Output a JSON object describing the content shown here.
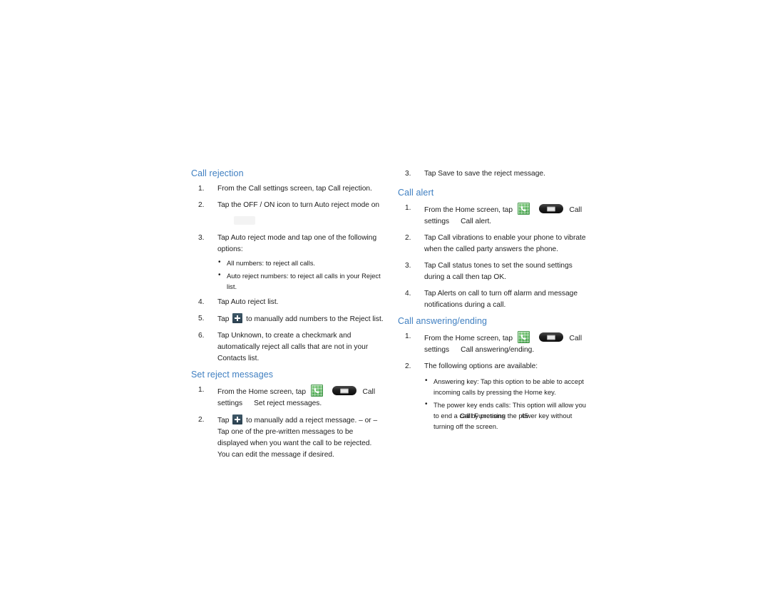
{
  "document": {
    "footer": {
      "chapter": "Call Functions",
      "page_number": "45"
    }
  },
  "left_column": {
    "sections": [
      {
        "heading": "Call rejection",
        "steps": [
          {
            "num": "1.",
            "text": "From the Call settings screen, tap Call rejection."
          },
          {
            "num": "2.",
            "text": "Tap the OFF / ON icon to turn Auto reject mode on"
          },
          {
            "num": "3.",
            "text": "Tap Auto reject mode and tap one of the following options:"
          },
          {
            "num": "4.",
            "text": "Tap Auto reject list."
          },
          {
            "num": "5.",
            "text": "Tap"
          },
          {
            "num": "6.",
            "text": "Tap Unknown, to create a checkmark and automatically reject all calls that are not in your Contacts list."
          }
        ],
        "step5_suffix": "to manually add numbers to the Reject list.",
        "bullets": [
          "All numbers: to reject all calls.",
          "Auto reject numbers: to reject all calls in your Reject list."
        ]
      },
      {
        "heading": "Set reject messages",
        "steps": [
          {
            "num": "1.",
            "text_before": "From the Home screen, tap",
            "text_after": "Call"
          },
          {
            "num": "2.",
            "text_before": "Tap",
            "text_after": "to manually add a reject message."
          }
        ],
        "step1_line2_a": "settings",
        "step1_line2_b": "Set reject messages.",
        "or_separator": "– or –",
        "paragraph": "Tap one of the pre-written messages to be displayed when you want the call to be rejected. You can edit the message if desired."
      }
    ]
  },
  "right_column": {
    "lead_step": {
      "num": "3.",
      "text": "Tap Save to save the reject message."
    },
    "sections": [
      {
        "heading": "Call alert",
        "steps": [
          {
            "num": "1.",
            "text_before": "From the Home screen, tap",
            "text_after": "Call"
          },
          {
            "num": "2.",
            "text": "Tap Call vibrations to enable your phone to vibrate when the called party answers the phone."
          },
          {
            "num": "3.",
            "text": "Tap Call status tones to set the sound settings during a call then tap OK."
          },
          {
            "num": "4.",
            "text": "Tap Alerts on call to turn off alarm and message notifications during a call."
          }
        ],
        "step1_line2_a": "settings",
        "step1_line2_b": "Call alert."
      },
      {
        "heading": "Call answering/ending",
        "steps": [
          {
            "num": "1.",
            "text_before": "From the Home screen, tap",
            "text_after": "Call"
          },
          {
            "num": "2.",
            "text": "The following options are available:"
          }
        ],
        "step1_line2_a": "settings",
        "step1_line2_b": "Call answering/ending.",
        "bullets": [
          "Answering key: Tap this option to be able to accept incoming calls by pressing the Home key.",
          "The power key ends calls: This option will allow you to end a call by pressing the power key without turning off the screen."
        ]
      }
    ]
  },
  "icons": {
    "phone": "phone-handset-icon",
    "menu": "menu-key-icon",
    "plus": "add-plus-icon",
    "toggle": "off-on-toggle-icon"
  },
  "colors": {
    "heading": "#3f7fc1",
    "body_text": "#1d1d1d",
    "phone_icon_green": "#5ab45d",
    "menu_icon_dark": "#1c1c1c",
    "plus_icon_slate": "#33495a"
  }
}
